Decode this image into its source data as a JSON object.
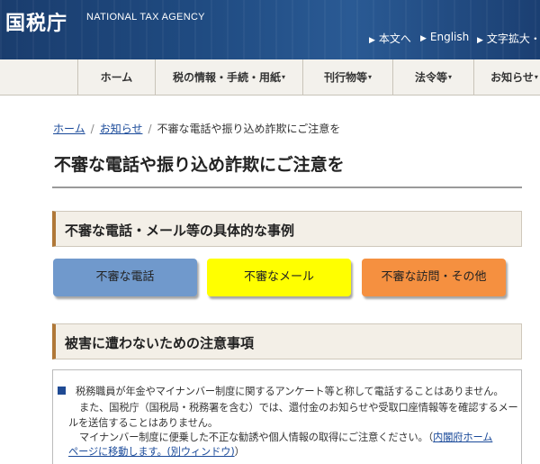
{
  "header": {
    "logo_text": "国税庁",
    "english_name": "NATIONAL TAX AGENCY",
    "util_links": [
      "本文へ",
      "English",
      "文字拡大・"
    ]
  },
  "nav": {
    "items": [
      "ホーム",
      "税の情報・手続・用紙",
      "刊行物等",
      "法令等",
      "お知らせ"
    ]
  },
  "breadcrumb": {
    "home": "ホーム",
    "notices": "お知らせ",
    "current": "不審な電話や振り込め詐欺にご注意を"
  },
  "page_title": "不審な電話や振り込め詐欺にご注意を",
  "section1": {
    "heading": "不審な電話・メール等の具体的な事例",
    "buttons": [
      {
        "label": "不審な電話",
        "color": "#7099cc"
      },
      {
        "label": "不審なメール",
        "color": "#ffff00"
      },
      {
        "label": "不審な訪問・その他",
        "color": "#f59040"
      }
    ]
  },
  "section2": {
    "heading": "被害に遭わないための注意事項"
  },
  "notice": {
    "line1": "税務職員が年金やマイナンバー制度に関するアンケート等と称して電話することはありません。",
    "line2": "また、国税庁（国税局・税務署を含む）では、還付金のお知らせや受取口座情報等を確認するメー",
    "line3": "ルを送信することはありません。",
    "line4": "マイナンバー制度に便乗した不正な勧誘や個人情報の取得にご注意ください。（",
    "link_part1": "内閣府ホーム",
    "link_part2": "ページに移動します。(別ウィンドウ)",
    "close_paren": "）"
  },
  "colors": {
    "header_bg": "#1f4a80",
    "accent_border": "#b07838",
    "link": "#1a4a9a"
  }
}
